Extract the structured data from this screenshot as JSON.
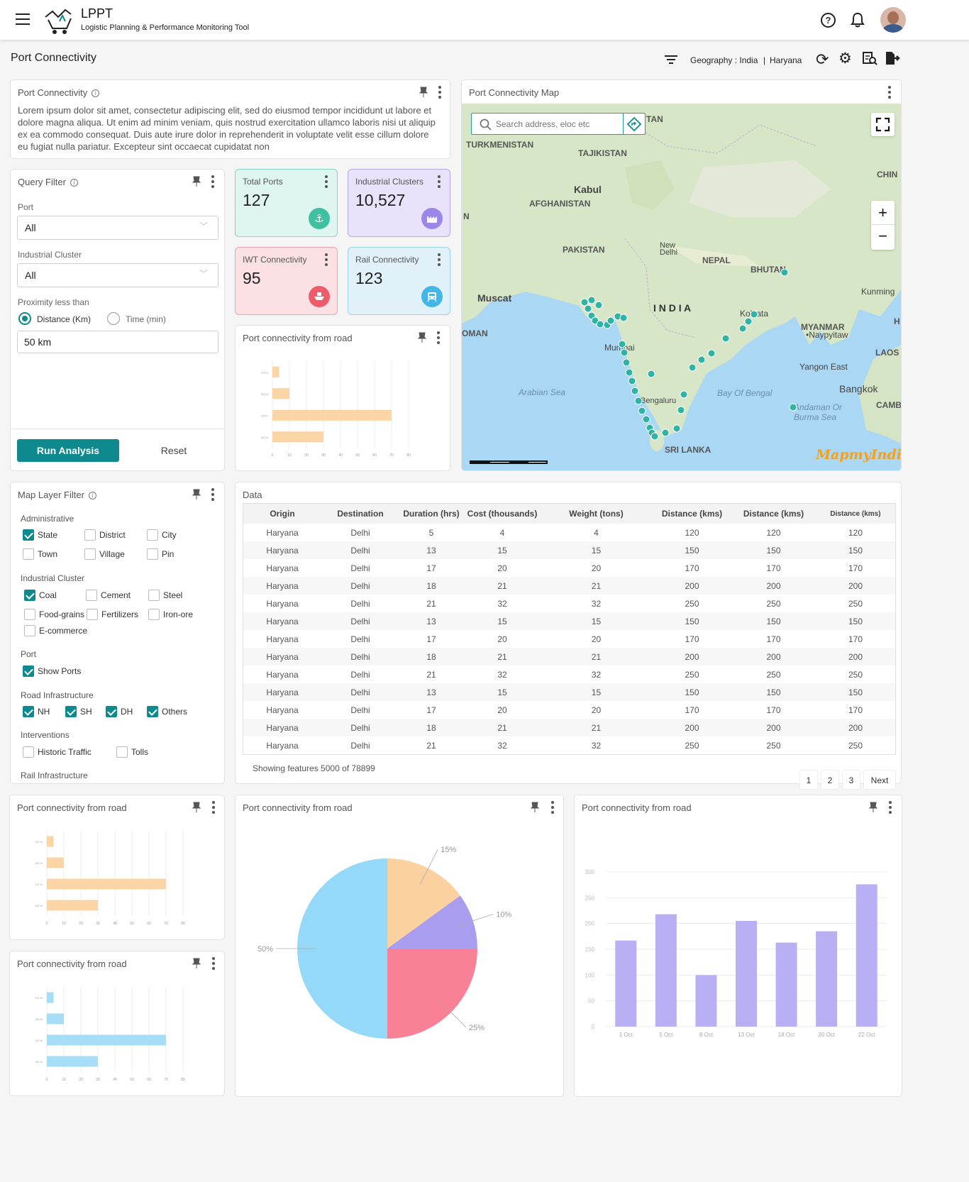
{
  "app": {
    "title": "LPPT",
    "subtitle": "Logistic Planning & Performance Monitoring Tool"
  },
  "page": {
    "title": "Port Connectivity",
    "geography_label": "Geography : India",
    "geography_region": "Haryana",
    "geography_sep": "|"
  },
  "description": {
    "title": "Port Connectivity",
    "text": "Lorem ipsum dolor sit amet, consectetur adipiscing elit, sed do eiusmod tempor incididunt ut labore et dolore magna aliqua. Ut enim ad minim veniam, quis nostrud exercitation ullamco laboris nisi ut aliquip ex ea commodo consequat. Duis aute irure dolor in reprehenderit in voluptate velit esse cillum dolore eu fugiat nulla pariatur. Excepteur sint occaecat cupidatat non"
  },
  "query_filter": {
    "title": "Query Filter",
    "port_label": "Port",
    "port_value": "All",
    "cluster_label": "Industrial Cluster",
    "cluster_value": "All",
    "proximity_label": "Proximity less than",
    "radio_distance": "Distance (Km)",
    "radio_time": "Time (min)",
    "proximity_value": "50 km",
    "run_label": "Run Analysis",
    "reset_label": "Reset"
  },
  "kpis": [
    {
      "title": "Total Ports",
      "value": "127",
      "bg": "#dff5ef",
      "border": "#86d6c3",
      "icon_bg": "#3fc0a1",
      "icon": "anchor-icon"
    },
    {
      "title": "Industrial Clusters",
      "value": "10,527",
      "bg": "#e8e3fa",
      "border": "#b7a9ef",
      "icon_bg": "#9b86ea",
      "icon": "factory-icon"
    },
    {
      "title": "IWT Connectivity",
      "value": "95",
      "bg": "#fbe1e4",
      "border": "#f1a3ad",
      "icon_bg": "#ee5b6a",
      "icon": "ship-icon"
    },
    {
      "title": "Rail Connectivity",
      "value": "123",
      "bg": "#e1f1fa",
      "border": "#9dd3ef",
      "icon_bg": "#42b6e6",
      "icon": "train-icon"
    }
  ],
  "map": {
    "title": "Port Connectivity Map",
    "search_placeholder": "Search address, eloc etc",
    "brand": "MapmyIndia",
    "labels": {
      "turkmenistan": "TURKMENISTAN",
      "tajikistan": "TAJIKISTAN",
      "tan": "TAN",
      "china": "CHIN",
      "kabul": "Kabul",
      "afghanistan": "AFGHANISTAN",
      "pakistan": "PAKISTAN",
      "new_delhi": "New Delhi",
      "nepal": "NEPAL",
      "bhutan": "BHUTAN",
      "kunming": "Kunming",
      "muscat": "Muscat",
      "oman": "OMAN",
      "india": "I N D I A",
      "kolkata": "Kolkata",
      "myanmar": "MYANMAR",
      "naypyitaw": "•Naypyitaw",
      "laos": "LAOS",
      "mumbai": "Mumbai",
      "yangon": "Yangon East",
      "arabian": "Arabian Sea",
      "bengal": "Bay Of Bengal",
      "bangkok": "Bangkok",
      "bengaluru": "Bengaluru",
      "andaman": "Andaman Or Burma Sea",
      "cam": "CAMB",
      "sri_lanka": "SRI LANKA",
      "n": "N",
      "h": "H"
    }
  },
  "layer_filter": {
    "title": "Map Layer Filter",
    "groups": [
      {
        "title": "Administrative",
        "items": [
          {
            "label": "State",
            "checked": true
          },
          {
            "label": "District",
            "checked": false
          },
          {
            "label": "City",
            "checked": false
          },
          {
            "label": "Town",
            "checked": false
          },
          {
            "label": "Village",
            "checked": false
          },
          {
            "label": "Pin",
            "checked": false
          }
        ]
      },
      {
        "title": "Industrial Cluster",
        "items": [
          {
            "label": "Coal",
            "checked": true
          },
          {
            "label": "Cement",
            "checked": false
          },
          {
            "label": "Steel",
            "checked": false
          },
          {
            "label": "Food-grains",
            "checked": false
          },
          {
            "label": "Fertilizers",
            "checked": false
          },
          {
            "label": "Iron-ore",
            "checked": false
          },
          {
            "label": "E-commerce",
            "checked": false
          }
        ]
      },
      {
        "title": "Port",
        "items": [
          {
            "label": "Show Ports",
            "checked": true
          }
        ]
      },
      {
        "title": "Road Infrastructure",
        "items": [
          {
            "label": "NH",
            "checked": true
          },
          {
            "label": "SH",
            "checked": true
          },
          {
            "label": "DH",
            "checked": true
          },
          {
            "label": "Others",
            "checked": true
          }
        ]
      },
      {
        "title": "Interventions",
        "items": [
          {
            "label": "Historic Traffic",
            "checked": false
          },
          {
            "label": "Tolls",
            "checked": false
          }
        ]
      },
      {
        "title": "Rail Infrastructure",
        "items": []
      }
    ]
  },
  "table": {
    "title": "Data",
    "columns": [
      "Origin",
      "Destination",
      "Duration (hrs)",
      "Cost (thousands)",
      "Weight (tons)",
      "Distance (kms)",
      "Distance (kms)",
      "Distance (kms)"
    ],
    "rows": [
      [
        "Haryana",
        "Delhi",
        "5",
        "4",
        "4",
        "120",
        "120",
        "120"
      ],
      [
        "Haryana",
        "Delhi",
        "13",
        "15",
        "15",
        "150",
        "150",
        "150"
      ],
      [
        "Haryana",
        "Delhi",
        "17",
        "20",
        "20",
        "170",
        "170",
        "170"
      ],
      [
        "Haryana",
        "Delhi",
        "18",
        "21",
        "21",
        "200",
        "200",
        "200"
      ],
      [
        "Haryana",
        "Delhi",
        "21",
        "32",
        "32",
        "250",
        "250",
        "250"
      ],
      [
        "Haryana",
        "Delhi",
        "13",
        "15",
        "15",
        "150",
        "150",
        "150"
      ],
      [
        "Haryana",
        "Delhi",
        "17",
        "20",
        "20",
        "170",
        "170",
        "170"
      ],
      [
        "Haryana",
        "Delhi",
        "18",
        "21",
        "21",
        "200",
        "200",
        "200"
      ],
      [
        "Haryana",
        "Delhi",
        "21",
        "32",
        "32",
        "250",
        "250",
        "250"
      ],
      [
        "Haryana",
        "Delhi",
        "13",
        "15",
        "15",
        "150",
        "150",
        "150"
      ],
      [
        "Haryana",
        "Delhi",
        "17",
        "20",
        "20",
        "170",
        "170",
        "170"
      ],
      [
        "Haryana",
        "Delhi",
        "18",
        "21",
        "21",
        "200",
        "200",
        "200"
      ],
      [
        "Haryana",
        "Delhi",
        "21",
        "32",
        "32",
        "250",
        "250",
        "250"
      ],
      [
        "Haryana",
        "Delhi",
        "13",
        "15",
        "15",
        "150",
        "150",
        "150"
      ]
    ],
    "footer": "Showing features 5000 of 78899",
    "pages": [
      "1",
      "2",
      "3"
    ],
    "next": "Next"
  },
  "chart_data": [
    {
      "type": "bar",
      "orientation": "horizontal",
      "title": "Port connectivity from road",
      "categories": [
        "1/2 hr",
        "3/4 hr",
        "1/2 hr",
        "0/4 hr"
      ],
      "values": [
        4,
        10,
        70,
        30
      ],
      "xlim": [
        0,
        80
      ],
      "xticks": [
        "0",
        "10",
        "20",
        "30",
        "40",
        "50",
        "60",
        "70",
        "80"
      ],
      "color": "#fcd5a6"
    },
    {
      "type": "bar",
      "orientation": "horizontal",
      "title": "Port connectivity from road",
      "categories": [
        "1/2 hr",
        "3/4 hr",
        "1/2 hr",
        "0/4 hr"
      ],
      "values": [
        4,
        10,
        70,
        30
      ],
      "xlim": [
        0,
        80
      ],
      "xticks": [
        "0",
        "10",
        "20",
        "30",
        "40",
        "50",
        "60",
        "70",
        "80"
      ],
      "color": "#fcd5a6"
    },
    {
      "type": "bar",
      "orientation": "horizontal",
      "title": "Port connectivity from road",
      "categories": [
        "1/2 hr",
        "3/4 hr",
        "1/2 hr",
        "0/4 hr"
      ],
      "values": [
        4,
        10,
        70,
        30
      ],
      "xlim": [
        0,
        80
      ],
      "xticks": [
        "0",
        "10",
        "20",
        "30",
        "40",
        "50",
        "60",
        "70",
        "80"
      ],
      "color": "#a6def8"
    },
    {
      "type": "pie",
      "title": "Port connectivity from road",
      "slices": [
        {
          "label": "15%",
          "value": 15,
          "color": "#fbd19f"
        },
        {
          "label": "10%",
          "value": 10,
          "color": "#a99df0"
        },
        {
          "label": "25%",
          "value": 25,
          "color": "#f88196"
        },
        {
          "label": "50%",
          "value": 50,
          "color": "#95d9f8"
        }
      ]
    },
    {
      "type": "bar",
      "title": "Port connectivity from road",
      "categories": [
        "1 Oct",
        "5 Oct",
        "8 Oct",
        "13 Oct",
        "18 Oct",
        "20 Oct",
        "22 Oct"
      ],
      "values": [
        167,
        218,
        100,
        205,
        163,
        185,
        276
      ],
      "ylim": [
        0,
        300
      ],
      "yticks": [
        "0",
        "50",
        "100",
        "150",
        "200",
        "250",
        "300"
      ],
      "color": "#b8aff4"
    }
  ]
}
